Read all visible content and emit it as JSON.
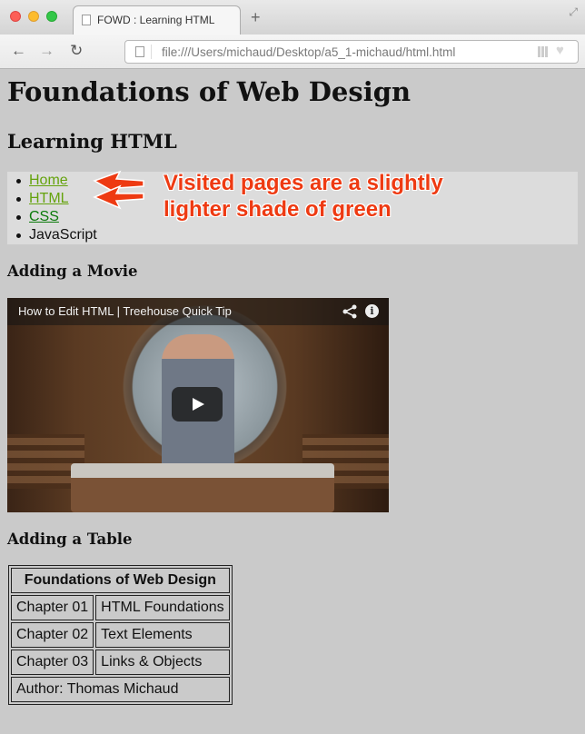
{
  "browser": {
    "tab_title": "FOWD : Learning HTML",
    "new_tab": "+",
    "url": "file:///Users/michaud/Desktop/a5_1-michaud/html.html"
  },
  "page": {
    "title": "Foundations of Web Design",
    "subtitle": "Learning HTML",
    "nav": [
      {
        "label": "Home",
        "state": "visited"
      },
      {
        "label": "HTML",
        "state": "visited"
      },
      {
        "label": "CSS",
        "state": "unvisited"
      },
      {
        "label": "JavaScript",
        "state": "plain"
      }
    ],
    "annotation": [
      "Visited pages are a slightly",
      "lighter shade of green"
    ],
    "movie_heading": "Adding a Movie",
    "video": {
      "title": "How to Edit HTML | Treehouse Quick Tip",
      "info": "i"
    },
    "table_heading": "Adding a Table",
    "table": {
      "caption": "Foundations of Web Design",
      "rows": [
        [
          "Chapter 01",
          "HTML Foundations"
        ],
        [
          "Chapter 02",
          "Text Elements"
        ],
        [
          "Chapter 03",
          "Links & Objects"
        ]
      ],
      "footer": "Author: Thomas Michaud"
    }
  },
  "colors": {
    "visited_link": "#65a30d",
    "unvisited_link": "#0b7a0b",
    "annotation": "#ee3a12"
  }
}
